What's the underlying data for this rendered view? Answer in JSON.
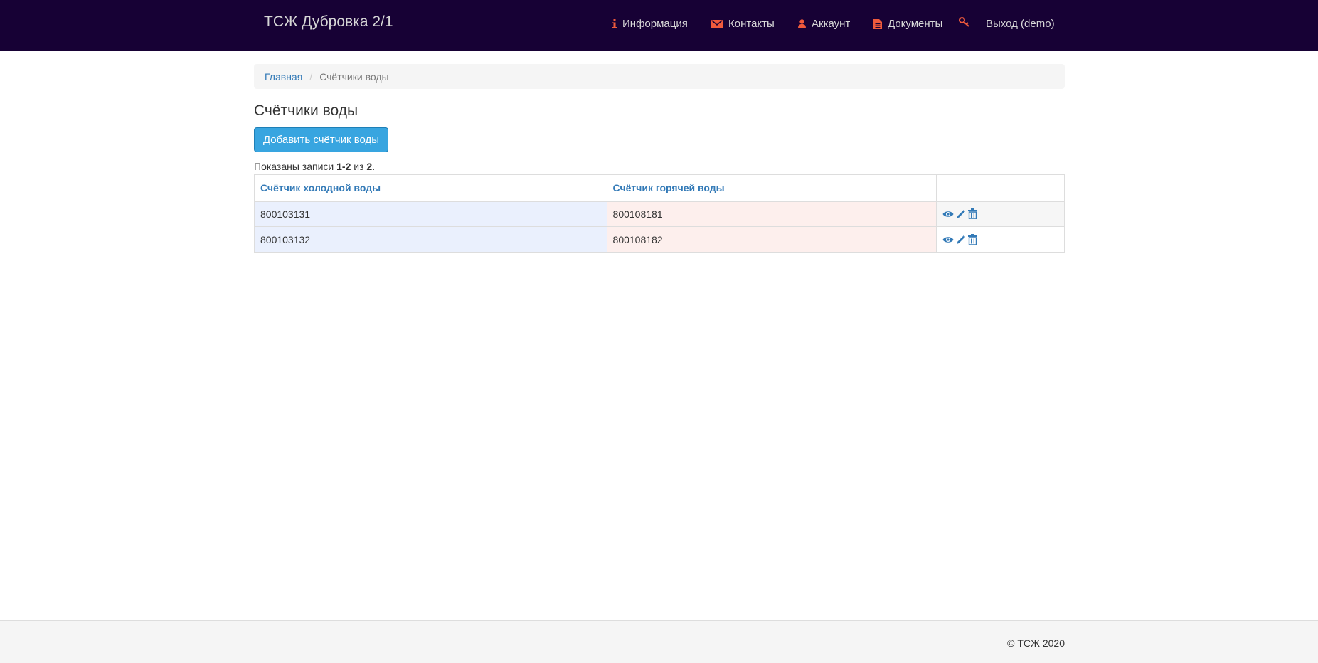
{
  "app": {
    "brand": "ТСЖ Дубровка 2/1"
  },
  "nav": {
    "items": [
      {
        "label": "Информация",
        "icon": "info-icon"
      },
      {
        "label": "Контакты",
        "icon": "envelope-icon"
      },
      {
        "label": "Аккаунт",
        "icon": "user-icon"
      },
      {
        "label": "Документы",
        "icon": "file-icon"
      },
      {
        "label": "Выход (demo)",
        "icon": "key-icon"
      }
    ]
  },
  "breadcrumb": {
    "home": "Главная",
    "current": "Счётчики воды"
  },
  "page": {
    "title": "Счётчики воды",
    "add_button": "Добавить счётчик воды",
    "summary": {
      "prefix": "Показаны записи ",
      "range": "1-2",
      "middle": " из ",
      "total": "2",
      "suffix": "."
    }
  },
  "table": {
    "columns": [
      "Счётчик холодной воды",
      "Счётчик горячей воды",
      ""
    ],
    "rows": [
      {
        "cold": "800103131",
        "hot": "800108181"
      },
      {
        "cold": "800103132",
        "hot": "800108182"
      }
    ],
    "row_actions": [
      "eye-icon",
      "pencil-icon",
      "trash-icon"
    ]
  },
  "footer": {
    "copyright": "© ТСЖ 2020"
  },
  "colors": {
    "navbar": "#170135",
    "nav_icon": "#ef5a3c",
    "link": "#337ab7",
    "button": "#38a5e0",
    "cold_cell": "#eaf0fd",
    "hot_cell": "#fdefed"
  }
}
